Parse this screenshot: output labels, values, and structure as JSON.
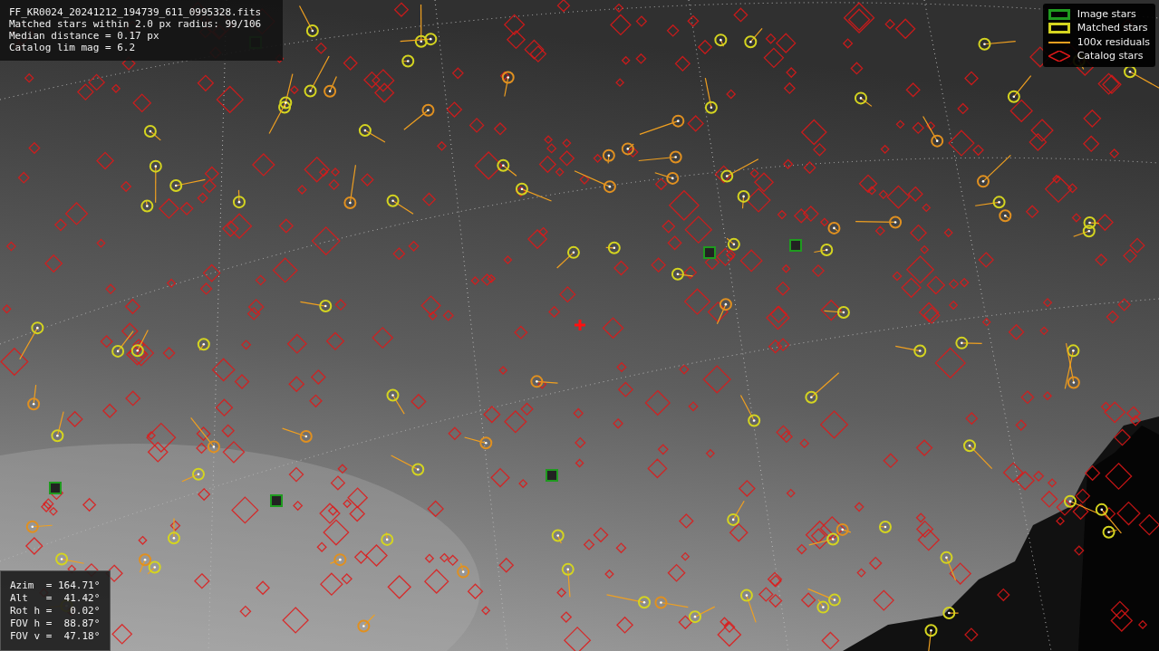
{
  "info_box": {
    "lines": [
      "FF_KR0024_20241212_194739_611_0995328.fits",
      "Matched stars within 2.0 px radius: 99/106",
      "Median distance = 0.17 px",
      "Catalog lim mag = 6.2"
    ]
  },
  "legend": [
    {
      "kind": "box",
      "color": "#1f9a1f",
      "label": "Image stars"
    },
    {
      "kind": "box",
      "color": "#d4d420",
      "label": "Matched stars"
    },
    {
      "kind": "line",
      "color": "#f0a020",
      "label": "100x residuals"
    },
    {
      "kind": "diamond",
      "color": "#e01818",
      "label": "Catalog stars"
    }
  ],
  "pointing_box": {
    "lines": [
      "Azim  = 164.71°",
      "Alt   =  41.42°",
      "Rot h =   0.02°",
      "FOV h =  88.87°",
      "FOV v =  47.18°"
    ]
  }
}
